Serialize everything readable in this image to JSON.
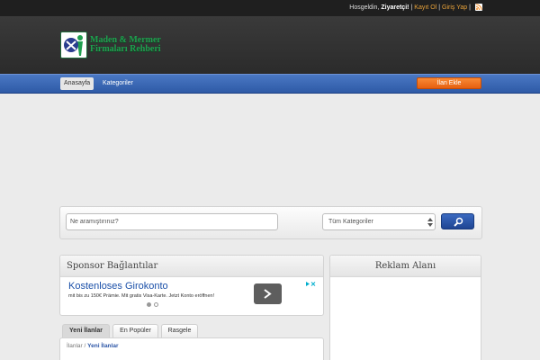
{
  "topbar": {
    "greeting": "Hosgeldin,",
    "user": "Ziyaretçi!",
    "sep1": "|",
    "register": "Kayıt Ol",
    "sep2": "|",
    "login": "Giriş Yap",
    "sep3": "|"
  },
  "logo": {
    "line1": "Maden & Mermer",
    "line2": "Firmaları Rehberi"
  },
  "nav": {
    "home": "Anasayfa",
    "categories": "Kategoriler",
    "post_ad": "İlan Ekle"
  },
  "search": {
    "placeholder": "Ne aramıştırınız?",
    "category_selected": "Tüm Kategoriler"
  },
  "sponsor": {
    "title": "Sponsor Bağlantılar",
    "ad_title": "Kostenloses Girokonto",
    "ad_desc": "mit bis zu 150€ Prämie. Mit gratis Visa-Karte. Jetzt Konto eröffnen!"
  },
  "reklam": {
    "title": "Reklam Alanı"
  },
  "tabs": [
    {
      "label": "Yeni İlanlar"
    },
    {
      "label": "En Popüler"
    },
    {
      "label": "Rasgele"
    }
  ],
  "breadcrumb": {
    "root": "İlanlar",
    "sep": "/",
    "current": "Yeni İlanlar"
  },
  "colors": {
    "nav_blue": "#3b68b6",
    "accent_orange": "#f07a2a",
    "logo_green": "#1fa04f",
    "link_orange": "#e8a23a"
  }
}
